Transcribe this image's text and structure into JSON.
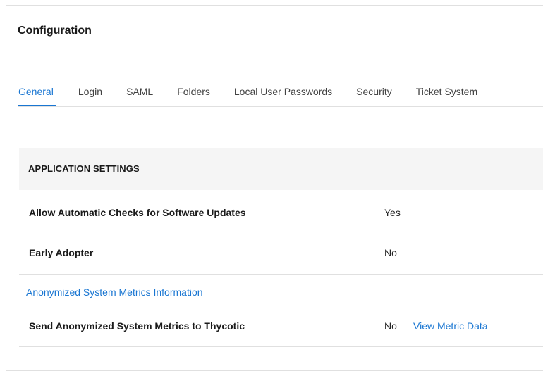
{
  "page": {
    "title": "Configuration"
  },
  "tabs": [
    {
      "label": "General",
      "active": true
    },
    {
      "label": "Login",
      "active": false
    },
    {
      "label": "SAML",
      "active": false
    },
    {
      "label": "Folders",
      "active": false
    },
    {
      "label": "Local User Passwords",
      "active": false
    },
    {
      "label": "Security",
      "active": false
    },
    {
      "label": "Ticket System",
      "active": false
    }
  ],
  "application_settings": {
    "header": "APPLICATION SETTINGS",
    "rows": [
      {
        "label": "Allow Automatic Checks for Software Updates",
        "value": "Yes"
      },
      {
        "label": "Early Adopter",
        "value": "No"
      }
    ],
    "metrics_info_link": "Anonymized System Metrics Information",
    "metrics_row": {
      "label": "Send Anonymized System Metrics to Thycotic",
      "value": "No",
      "link": "View Metric Data"
    }
  },
  "colors": {
    "accent": "#1976d2",
    "header_bg": "#f5f5f5",
    "divider": "#e0e0e0"
  }
}
